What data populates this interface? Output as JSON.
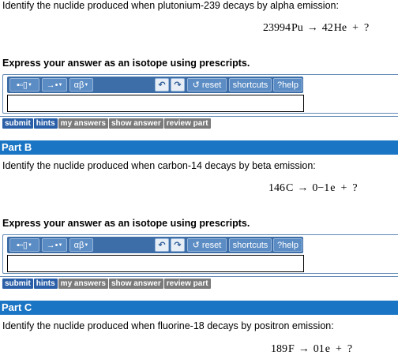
{
  "toolbar": {
    "templates_icon": "templates-icon",
    "arrow_label": "→•",
    "greek_label": "αβ",
    "undo_icon": "undo-icon",
    "redo_icon": "redo-icon",
    "reset_label": "reset",
    "shortcuts_label": "shortcuts",
    "help_label": "help",
    "help_icon": "?"
  },
  "buttons": {
    "submit": "submit",
    "hints": "hints",
    "my_answers": "my answers",
    "show_answer": "show answer",
    "review_part": "review part"
  },
  "express_text": "Express your answer as an isotope using prescripts.",
  "part_a": {
    "question": "Identify the nuclide produced when plutonium-239 decays by alpha emission:",
    "eq": {
      "r_mass": "239",
      "r_atomic": "94",
      "r_symbol": "Pu",
      "p_mass": "4",
      "p_atomic": "2",
      "p_symbol": "He",
      "arrow": "→",
      "plus": "+",
      "unknown": "?"
    },
    "answer_value": ""
  },
  "part_b": {
    "title": "Part B",
    "question": "Identify the nuclide produced when carbon-14 decays by beta emission:",
    "eq": {
      "r_mass": "14",
      "r_atomic": "6",
      "r_symbol": "C",
      "p_mass": "0",
      "p_atomic": "−1",
      "p_symbol": "e",
      "arrow": "→",
      "plus": "+",
      "unknown": "?"
    },
    "answer_value": ""
  },
  "part_c": {
    "title": "Part C",
    "question": "Identify the nuclide produced when fluorine-18 decays by positron emission:",
    "eq": {
      "r_mass": "18",
      "r_atomic": "9",
      "r_symbol": "F",
      "p_mass": "0",
      "p_atomic": "1",
      "p_symbol": "e",
      "arrow": "→",
      "plus": "+",
      "unknown": "?"
    }
  },
  "colors": {
    "part_bar": "#1a75c4",
    "toolbar": "#3d6ea8",
    "button_blue": "#2a5fa8",
    "button_gray": "#7b7b7b"
  }
}
